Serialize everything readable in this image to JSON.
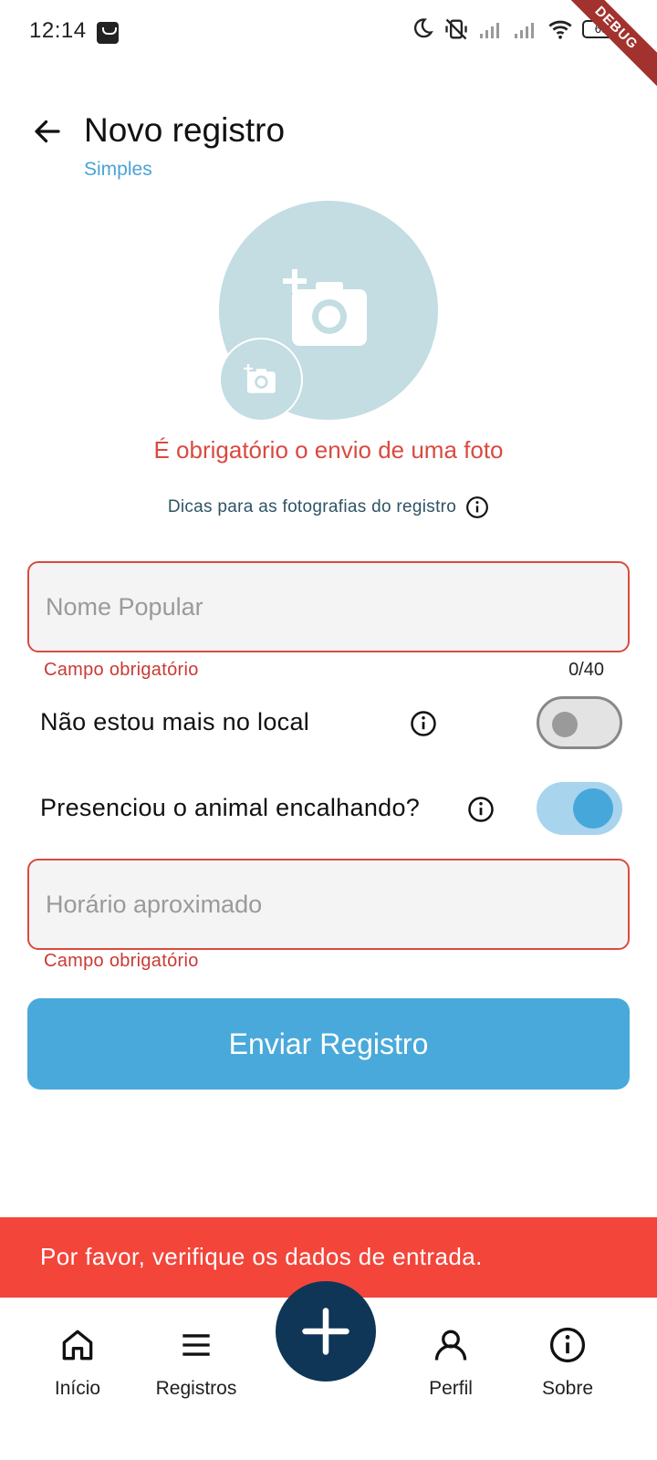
{
  "status_bar": {
    "time": "12:14",
    "battery": "68",
    "debug_banner": "DEBUG",
    "icons": [
      "shopping-bag-icon",
      "moon-icon",
      "vibrate-off-icon",
      "signal-icon",
      "signal-icon",
      "wifi-icon",
      "battery-icon"
    ]
  },
  "header": {
    "title": "Novo registro",
    "subtitle": "Simples",
    "back_icon": "arrow-left-icon"
  },
  "photo": {
    "main_icon": "add-photo-icon",
    "small_icon": "add-photo-icon",
    "error": "É obrigatório o envio de uma foto",
    "tips_label": "Dicas para as fotografias do registro"
  },
  "form": {
    "name_field": {
      "placeholder": "Nome Popular",
      "value": "",
      "error": "Campo obrigatório",
      "counter": "0/40"
    },
    "not_on_site": {
      "label": "Não estou mais no local",
      "state": "off"
    },
    "witnessed_stranding": {
      "label": "Presenciou o animal encalhando?",
      "state": "on"
    },
    "time_field": {
      "placeholder": "Horário aproximado",
      "value": "",
      "error": "Campo obrigatório"
    },
    "submit_label": "Enviar Registro"
  },
  "snackbar": {
    "message": "Por favor, verifique os dados de entrada."
  },
  "bottom_nav": {
    "items": [
      {
        "label": "Início",
        "icon": "home-icon"
      },
      {
        "label": "Registros",
        "icon": "menu-icon"
      },
      {
        "label": "Perfil",
        "icon": "user-icon"
      },
      {
        "label": "Sobre",
        "icon": "info-icon"
      }
    ],
    "fab_icon": "plus-icon"
  },
  "colors": {
    "accent": "#49a9da",
    "error": "#d94a40",
    "snackbar": "#f3453a",
    "fab": "#0f3657",
    "photo_bg": "#c3dde2"
  }
}
